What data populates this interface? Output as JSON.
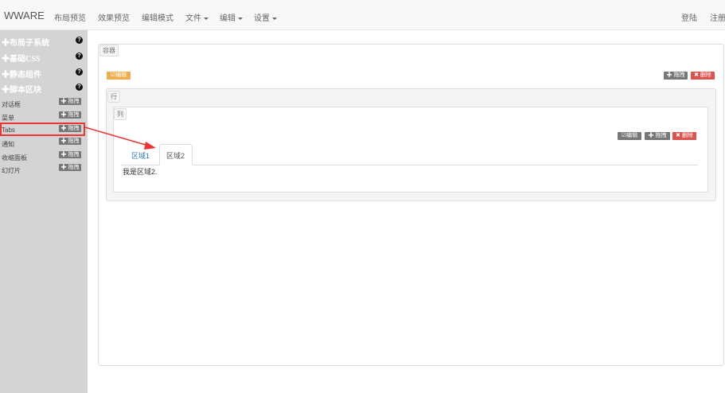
{
  "navbar": {
    "brand": "WWARE",
    "items": [
      "布局预览",
      "效果预览",
      "编辑模式",
      "文件",
      "编辑",
      "设置"
    ],
    "right": [
      "登陆",
      "注册"
    ]
  },
  "sidebar": {
    "sections": [
      "✚布局子系统",
      "✚基础CSS",
      "✚静态组件",
      "✚脚本区块"
    ],
    "help_glyph": "?",
    "items": [
      "对话框",
      "菜单",
      "Tabs",
      "通知",
      "收缩面板",
      "幻灯片"
    ],
    "drag_label": "✚ 拖拽"
  },
  "main": {
    "container_label": "容器",
    "row_label": "行",
    "col_label": "列",
    "edit_label": "☑编辑",
    "drag_label": "✚ 拖拽",
    "delete_label": "✖ 删除",
    "tabs": [
      "区域1",
      "区域2"
    ],
    "tab_content": "我是区域2."
  },
  "colors": {
    "highlight": "#e33333",
    "edit": "#f0ad4e",
    "delete": "#d9534f",
    "sidebar_bg": "#d4d4d4"
  }
}
